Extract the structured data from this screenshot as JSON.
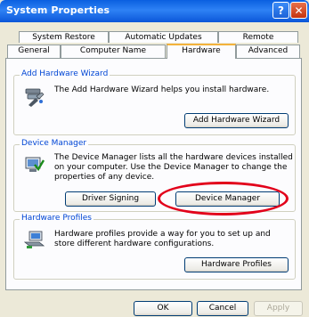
{
  "window": {
    "title": "System Properties",
    "help_glyph": "?",
    "close_glyph": "✕"
  },
  "tabs": {
    "row_back": [
      "System Restore",
      "Automatic Updates",
      "Remote"
    ],
    "row_front": [
      "General",
      "Computer Name",
      "Hardware",
      "Advanced"
    ],
    "active": "Hardware"
  },
  "groups": {
    "add_hardware": {
      "label": "Add Hardware Wizard",
      "text": "The Add Hardware Wizard helps you install hardware.",
      "button": "Add Hardware Wizard",
      "icon": "hardware-wizard-icon"
    },
    "device_manager": {
      "label": "Device Manager",
      "text": "The Device Manager lists all the hardware devices installed on your computer. Use the Device Manager to change the properties of any device.",
      "button_signing": "Driver Signing",
      "button_manager": "Device Manager",
      "icon": "device-manager-icon"
    },
    "profiles": {
      "label": "Hardware Profiles",
      "text": "Hardware profiles provide a way for you to set up and store different hardware configurations.",
      "button": "Hardware Profiles",
      "icon": "hardware-profiles-icon"
    }
  },
  "footer": {
    "ok": "OK",
    "cancel": "Cancel",
    "apply": "Apply"
  },
  "colors": {
    "titlebar": "#0a5fe0",
    "group_label": "#0046d5",
    "highlight_ellipse": "#e2001a"
  }
}
